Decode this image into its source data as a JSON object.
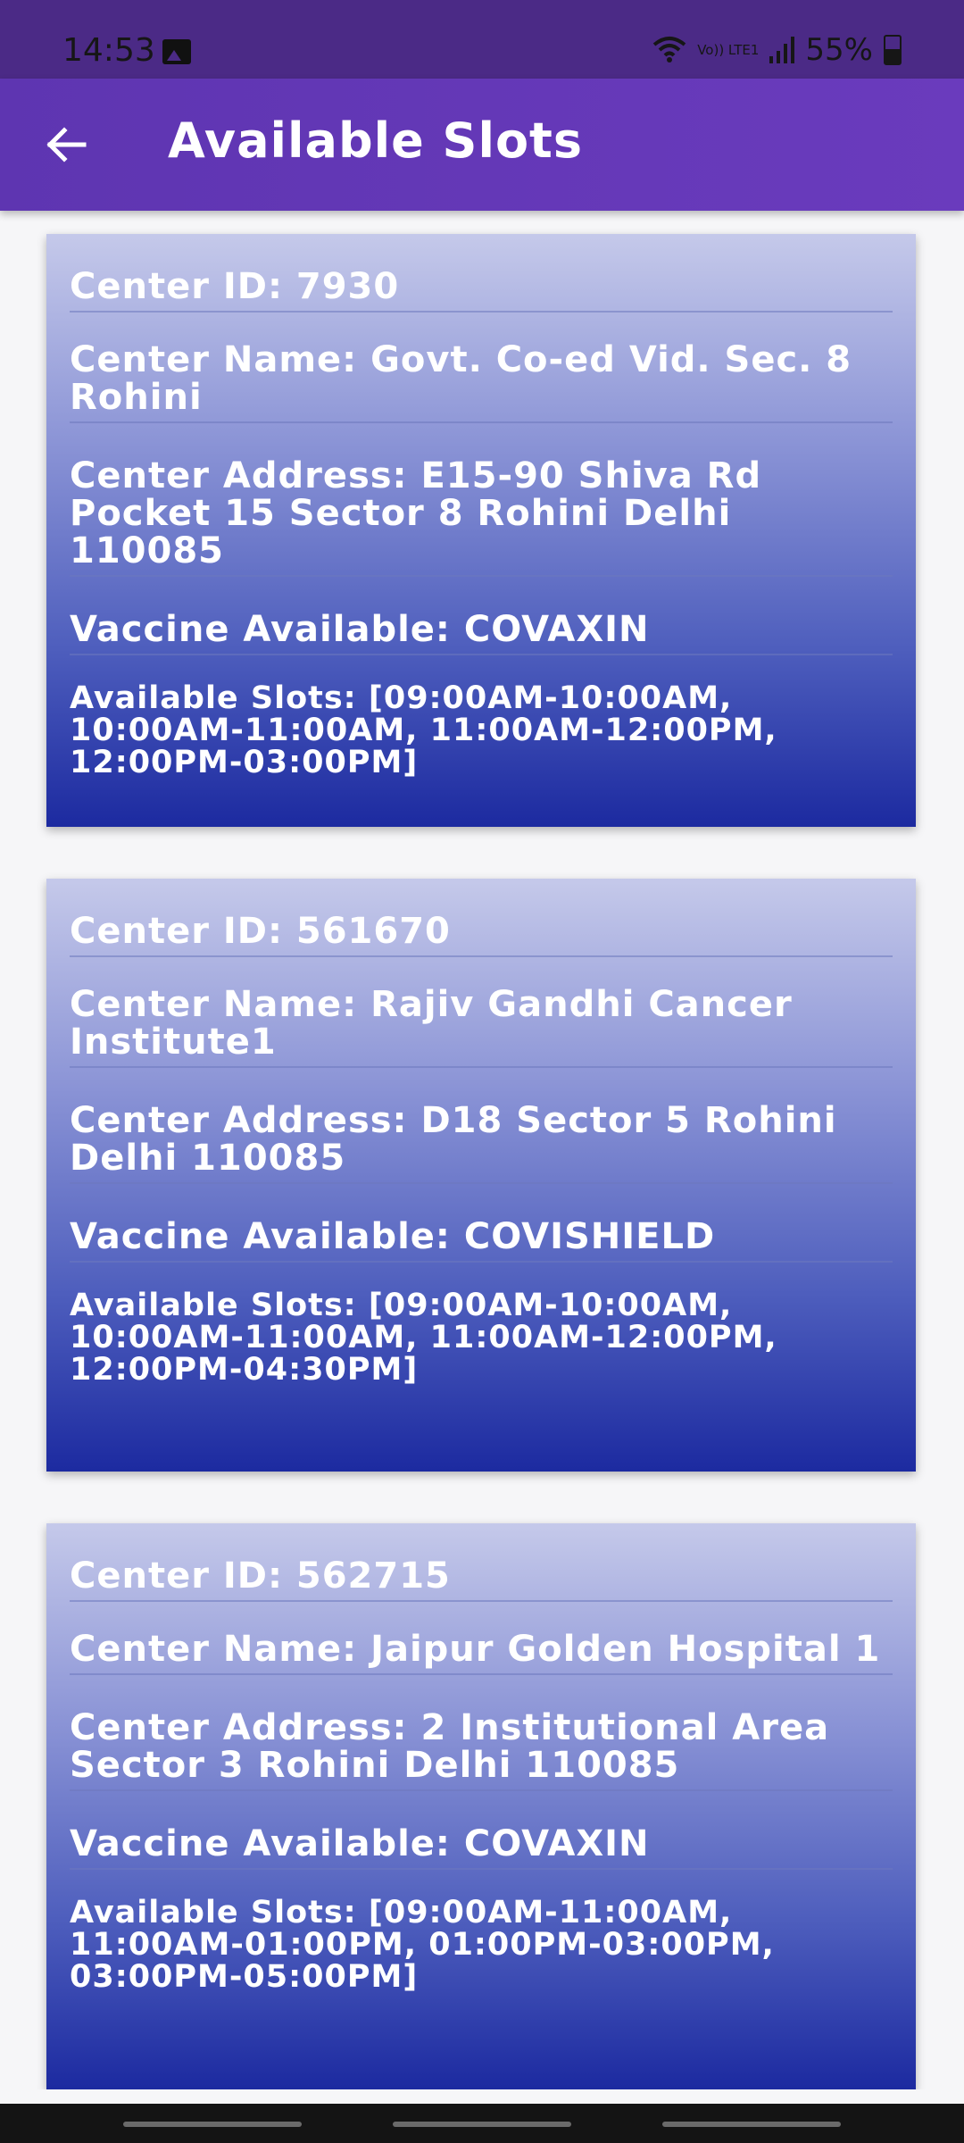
{
  "status_bar": {
    "time": "14:53",
    "network": "Vo)) LTE1",
    "battery": "55%"
  },
  "app_bar": {
    "title": "Available Slots"
  },
  "cards": [
    {
      "center_id": "Center ID: 7930",
      "center_name": "Center Name: Govt. Co-ed Vid. Sec. 8 Rohini",
      "center_address": "Center Address: E15-90 Shiva Rd Pocket 15 Sector 8 Rohini Delhi 110085",
      "vaccine": "Vaccine Available: COVAXIN",
      "slots": "Available Slots: [09:00AM-10:00AM, 10:00AM-11:00AM, 11:00AM-12:00PM, 12:00PM-03:00PM]"
    },
    {
      "center_id": "Center ID: 561670",
      "center_name": "Center Name: Rajiv Gandhi Cancer Institute1",
      "center_address": "Center Address: D18 Sector 5 Rohini Delhi 110085",
      "vaccine": "Vaccine Available: COVISHIELD",
      "slots": "Available Slots: [09:00AM-10:00AM, 10:00AM-11:00AM, 11:00AM-12:00PM, 12:00PM-04:30PM]"
    },
    {
      "center_id": "Center ID: 562715",
      "center_name": "Center Name: Jaipur Golden Hospital 1",
      "center_address": "Center Address: 2 Institutional Area Sector 3  Rohini Delhi 110085",
      "vaccine": "Vaccine Available: COVAXIN",
      "slots": "Available Slots: [09:00AM-11:00AM, 11:00AM-01:00PM, 01:00PM-03:00PM, 03:00PM-05:00PM]"
    }
  ]
}
